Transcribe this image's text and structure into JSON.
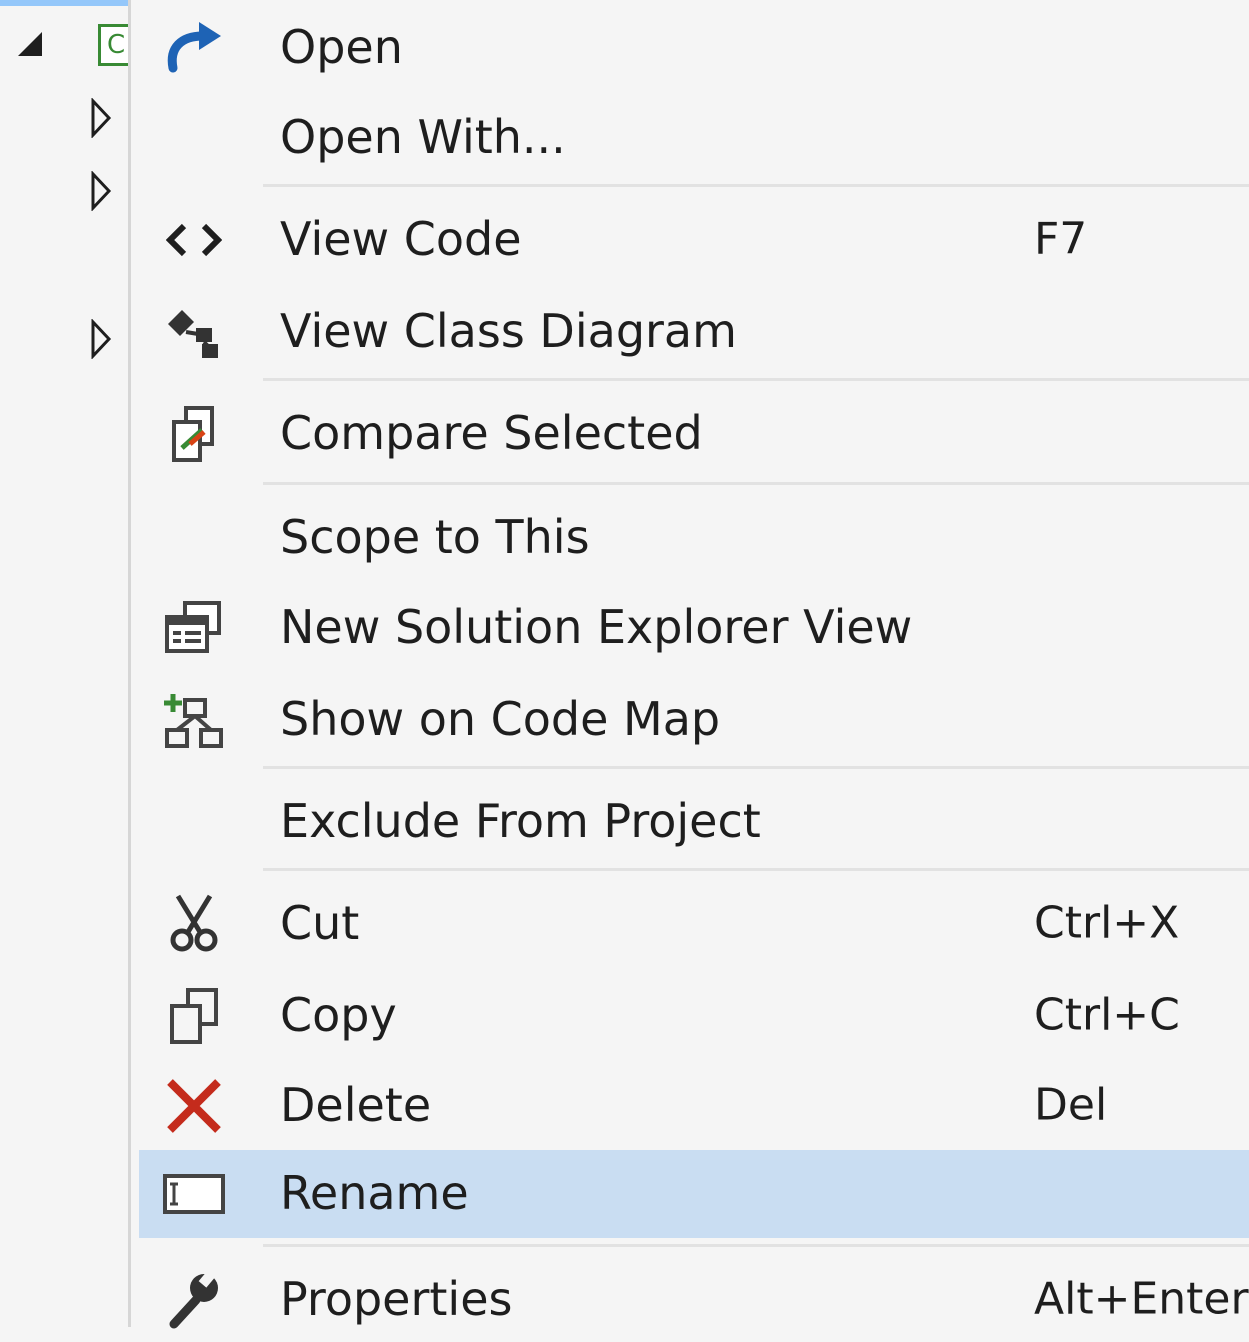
{
  "menu": {
    "items": [
      {
        "label": "Open",
        "shortcut": "",
        "icon": "redo-arrow-icon"
      },
      {
        "label": "Open With...",
        "shortcut": "",
        "icon": ""
      },
      {
        "label": "View Code",
        "shortcut": "F7",
        "icon": "code-brackets-icon"
      },
      {
        "label": "View Class Diagram",
        "shortcut": "",
        "icon": "class-diagram-icon"
      },
      {
        "label": "Compare Selected",
        "shortcut": "",
        "icon": "compare-files-icon"
      },
      {
        "label": "Scope to This",
        "shortcut": "",
        "icon": ""
      },
      {
        "label": "New Solution Explorer View",
        "shortcut": "",
        "icon": "new-window-icon"
      },
      {
        "label": "Show on Code Map",
        "shortcut": "",
        "icon": "code-map-icon"
      },
      {
        "label": "Exclude From Project",
        "shortcut": "",
        "icon": ""
      },
      {
        "label": "Cut",
        "shortcut": "Ctrl+X",
        "icon": "scissors-icon"
      },
      {
        "label": "Copy",
        "shortcut": "Ctrl+C",
        "icon": "copy-icon"
      },
      {
        "label": "Delete",
        "shortcut": "Del",
        "icon": "delete-x-icon"
      },
      {
        "label": "Rename",
        "shortcut": "",
        "icon": "rename-icon",
        "highlighted": true
      },
      {
        "label": "Properties",
        "shortcut": "Alt+Enter",
        "icon": "wrench-icon"
      }
    ]
  },
  "tree": {
    "project_icon_letter": "C"
  },
  "colors": {
    "highlight": "#c9ddf2",
    "delete": "#c42b1c",
    "open_arrow": "#1e63b5",
    "code_map_plus": "#388a34"
  }
}
